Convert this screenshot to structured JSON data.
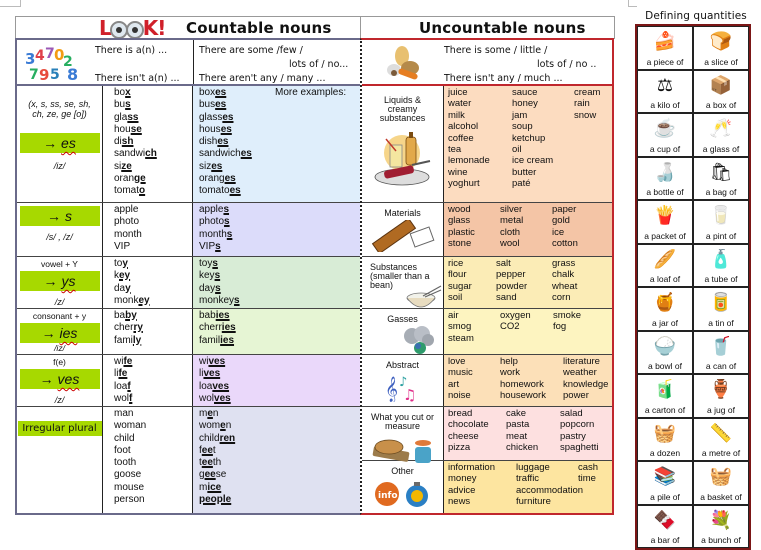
{
  "header": {
    "logo": "LOOK!",
    "countable_title": "Countable nouns",
    "uncountable_title": "Uncountable nouns"
  },
  "countable": {
    "intro": {
      "image": "numbers-image",
      "singular_pos": "There is a(n) ...",
      "singular_neg": "There isn't a(n) ...",
      "plural_pos_1": "There are some /few /",
      "plural_pos_2": "lots of / no...",
      "plural_neg": "There aren't any / many ..."
    },
    "more_examples": "More examples:",
    "rules": [
      {
        "condition": "(x, s, ss, se, sh, ch, ze, ge [o])",
        "ending": "es",
        "pronunciation": "/iz/",
        "singular": [
          "box",
          "bus",
          "glass",
          "house",
          "dish",
          "sandwich",
          "size",
          "orange",
          "tomato"
        ],
        "plural": [
          "boxes",
          "buses",
          "glasses",
          "houses",
          "dishes",
          "sandwiches",
          "sizes",
          "oranges",
          "tomatoes"
        ]
      },
      {
        "condition": "",
        "ending": "s",
        "pronunciation": "/s/ , /z/",
        "singular": [
          "apple",
          "photo",
          "month",
          "VIP"
        ],
        "plural": [
          "apples",
          "photos",
          "months",
          "VIPs"
        ]
      },
      {
        "condition": "vowel + Y",
        "ending": "ys",
        "pronunciation": "/z/",
        "singular": [
          "toy",
          "key",
          "day",
          "monkey"
        ],
        "plural": [
          "toys",
          "keys",
          "days",
          "monkeys"
        ]
      },
      {
        "condition": "consonant + y",
        "ending": "ies",
        "pronunciation": "/iz/",
        "singular": [
          "baby",
          "cherry",
          "family"
        ],
        "plural": [
          "babies",
          "cherries",
          "families"
        ]
      },
      {
        "condition": "f(e)",
        "ending": "ves",
        "pronunciation": "/z/",
        "singular": [
          "wife",
          "life",
          "loaf",
          "wolf"
        ],
        "plural": [
          "wives",
          "lives",
          "loaves",
          "wolves"
        ]
      },
      {
        "condition": "",
        "ending": "Irregular plural",
        "pronunciation": "",
        "singular": [
          "man",
          "woman",
          "child",
          "foot",
          "tooth",
          "goose",
          "mouse",
          "person"
        ],
        "plural": [
          "men",
          "women",
          "children",
          "feet",
          "teeth",
          "geese",
          "mice",
          "people"
        ]
      }
    ]
  },
  "uncountable": {
    "intro": {
      "image": "food-image",
      "pos_1": "There is some / little /",
      "pos_2": "lots of / no ..",
      "neg": "There isn't any / much ..."
    },
    "categories": [
      {
        "name": "Liquids & creamy substances",
        "icon": "drinks-icon",
        "color": "#fcdcc0",
        "columns": [
          [
            "juice",
            "water",
            "milk",
            "alcohol",
            "coffee",
            "tea",
            "lemonade",
            "wine",
            "yoghurt"
          ],
          [
            "sauce",
            "honey",
            "jam",
            "soup",
            "ketchup",
            "oil",
            "ice cream",
            "butter",
            "paté"
          ],
          [
            "cream",
            "rain",
            "snow"
          ]
        ]
      },
      {
        "name": "Materials",
        "icon": "wood-paper-icon",
        "color": "#f4c5a6",
        "columns": [
          [
            "wood",
            "glass",
            "plastic",
            "stone"
          ],
          [
            "silver",
            "metal",
            "cloth",
            "wool"
          ],
          [
            "paper",
            "gold",
            "ice",
            "cotton"
          ]
        ]
      },
      {
        "name": "Substances (smaller than a bean)",
        "icon": "rice-bowl-icon",
        "color": "#fbecb6",
        "columns": [
          [
            "rice",
            "flour",
            "sugar",
            "soil"
          ],
          [
            "salt",
            "pepper",
            "powder",
            "sand"
          ],
          [
            "grass",
            "chalk",
            "wheat",
            "corn"
          ]
        ]
      },
      {
        "name": "Gasses",
        "icon": "smoke-icon",
        "color": "#fdf4c0",
        "columns": [
          [
            "air",
            "smog",
            "steam"
          ],
          [
            "oxygen",
            "CO2"
          ],
          [
            "smoke",
            "fog"
          ]
        ]
      },
      {
        "name": "Abstract",
        "icon": "music-notes-icon",
        "color": "#fce0b8",
        "columns": [
          [
            "love",
            "music",
            "art",
            "noise"
          ],
          [
            "help",
            "work",
            "homework",
            "housework"
          ],
          [
            "literature",
            "weather",
            "knowledge",
            "power"
          ]
        ]
      },
      {
        "name": "What you cut or measure",
        "icon": "bread-scale-icon",
        "color": "#fde0e0",
        "columns": [
          [
            "bread",
            "chocolate",
            "cheese",
            "pizza"
          ],
          [
            "cake",
            "pasta",
            "meat",
            "chicken"
          ],
          [
            "salad",
            "popcorn",
            "pastry",
            "spaghetti"
          ]
        ]
      },
      {
        "name": "Other",
        "icon": "info-icon",
        "color": "#fde5a0",
        "columns": [
          [
            "information",
            "money",
            "advice",
            "news"
          ],
          [
            "luggage",
            "traffic",
            "accommodation",
            "furniture"
          ],
          [
            "cash",
            "time"
          ]
        ]
      }
    ]
  },
  "quantities": {
    "title": "Defining quantities",
    "items": [
      {
        "label": "a piece of",
        "icon": "cake-slice-icon",
        "glyph": "🍰"
      },
      {
        "label": "a slice of",
        "icon": "bread-slices-icon",
        "glyph": "🍞"
      },
      {
        "label": "a kilo of",
        "icon": "scale-icon",
        "glyph": "⚖"
      },
      {
        "label": "a box of",
        "icon": "tissue-box-icon",
        "glyph": "📦"
      },
      {
        "label": "a cup of",
        "icon": "cup-icon",
        "glyph": "☕"
      },
      {
        "label": "a glass of",
        "icon": "champagne-glasses-icon",
        "glyph": "🥂"
      },
      {
        "label": "a bottle of",
        "icon": "bottle-icon",
        "glyph": "🍶"
      },
      {
        "label": "a bag of",
        "icon": "grocery-bag-icon",
        "glyph": "🛍"
      },
      {
        "label": "a packet of",
        "icon": "crisps-packet-icon",
        "glyph": "🍟"
      },
      {
        "label": "a pint of",
        "icon": "measuring-jug-icon",
        "glyph": "🥛"
      },
      {
        "label": "a loaf of",
        "icon": "loaf-icon",
        "glyph": "🥖"
      },
      {
        "label": "a tube of",
        "icon": "tube-icon",
        "glyph": "🧴"
      },
      {
        "label": "a jar of",
        "icon": "jar-icon",
        "glyph": "🍯"
      },
      {
        "label": "a tin of",
        "icon": "tin-can-icon",
        "glyph": "🥫"
      },
      {
        "label": "a bowl of",
        "icon": "bowl-icon",
        "glyph": "🍚"
      },
      {
        "label": "a can of",
        "icon": "soda-can-icon",
        "glyph": "🥤"
      },
      {
        "label": "a carton of",
        "icon": "milk-carton-icon",
        "glyph": "🧃"
      },
      {
        "label": "a jug of",
        "icon": "jug-icon",
        "glyph": "🏺"
      },
      {
        "label": "a dozen",
        "icon": "stack-icon",
        "glyph": "🧺"
      },
      {
        "label": "a metre of",
        "icon": "tape-measure-icon",
        "glyph": "📏"
      },
      {
        "label": "a pile of",
        "icon": "pile-of-books-icon",
        "glyph": "📚"
      },
      {
        "label": "a basket of",
        "icon": "flower-basket-icon",
        "glyph": "🧺"
      },
      {
        "label": "a bar of",
        "icon": "chocolate-bar-icon",
        "glyph": "🍫"
      },
      {
        "label": "a bunch of",
        "icon": "bouquet-icon",
        "glyph": "💐"
      }
    ]
  }
}
